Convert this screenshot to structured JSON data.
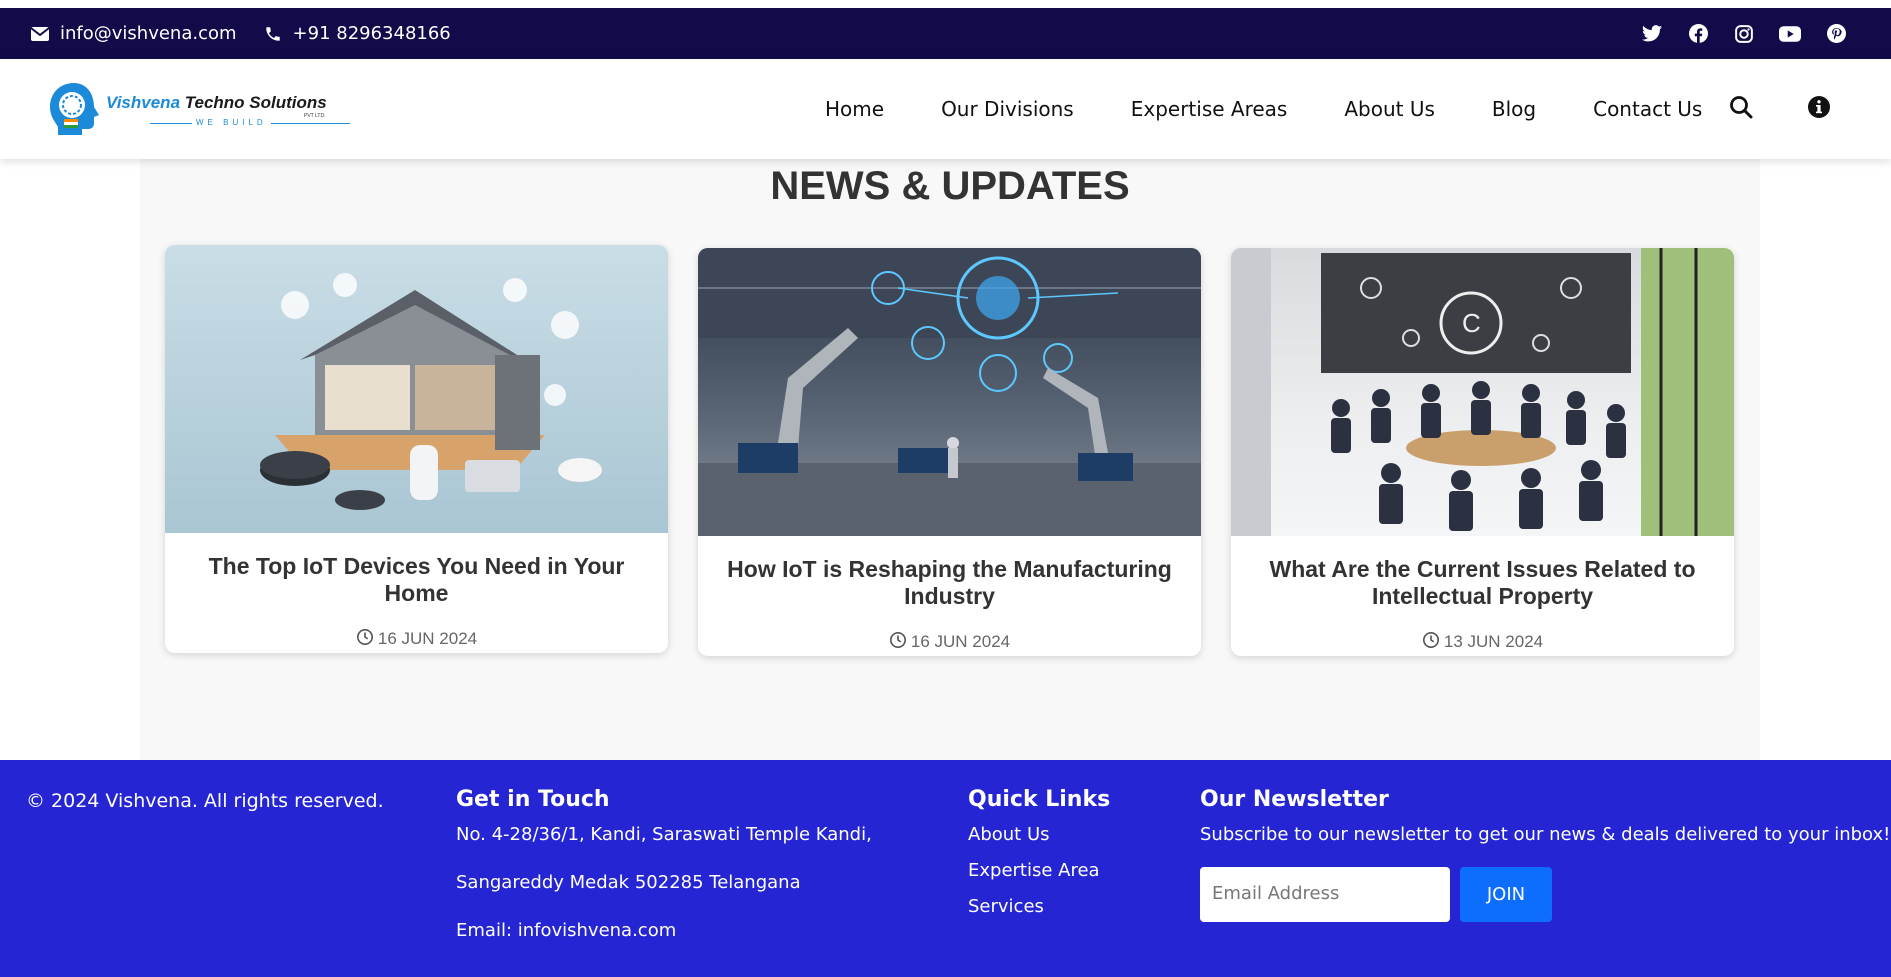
{
  "topbar": {
    "email": "info@vishvena.com",
    "phone": "+91 8296348166",
    "socials": [
      "twitter-icon",
      "facebook-icon",
      "instagram-icon",
      "youtube-icon",
      "pinterest-icon"
    ]
  },
  "logo": {
    "name_part1": "Vishvena",
    "name_part2": " Techno Solutions",
    "tagline": "WE BUILD",
    "suffix": "PVT LTD."
  },
  "nav": {
    "items": [
      "Home",
      "Our Divisions",
      "Expertise Areas",
      "About Us",
      "Blog",
      "Contact Us"
    ]
  },
  "news": {
    "title": "NEWS & UPDATES",
    "cards": [
      {
        "title": "The Top IoT Devices You Need in Your Home",
        "date": "16 JUN 2024"
      },
      {
        "title": "How IoT is Reshaping the Manufacturing Industry",
        "date": "16 JUN 2024"
      },
      {
        "title": "What Are the Current Issues Related to Intellectual Property",
        "date": "13 JUN 2024"
      }
    ]
  },
  "footer": {
    "copyright": "© 2024 Vishvena. All rights reserved.",
    "get_in_touch": {
      "heading": "Get in Touch",
      "address_line1": "No. 4-28/36/1, Kandi, Saraswati Temple Kandi,",
      "address_line2": "Sangareddy Medak 502285 Telangana",
      "email": "Email: infovishvena.com"
    },
    "quick_links": {
      "heading": "Quick Links",
      "items": [
        "About Us",
        "Expertise Area",
        "Services"
      ]
    },
    "newsletter": {
      "heading": "Our Newsletter",
      "text": "Subscribe to our newsletter to get our news & deals delivered to your inbox!",
      "placeholder": "Email Address",
      "button": "JOIN"
    }
  },
  "colors": {
    "topbar": "#110b4a",
    "footer": "#2525d4",
    "join_button": "#0d6efd",
    "brand_blue": "#1b8ad8"
  }
}
